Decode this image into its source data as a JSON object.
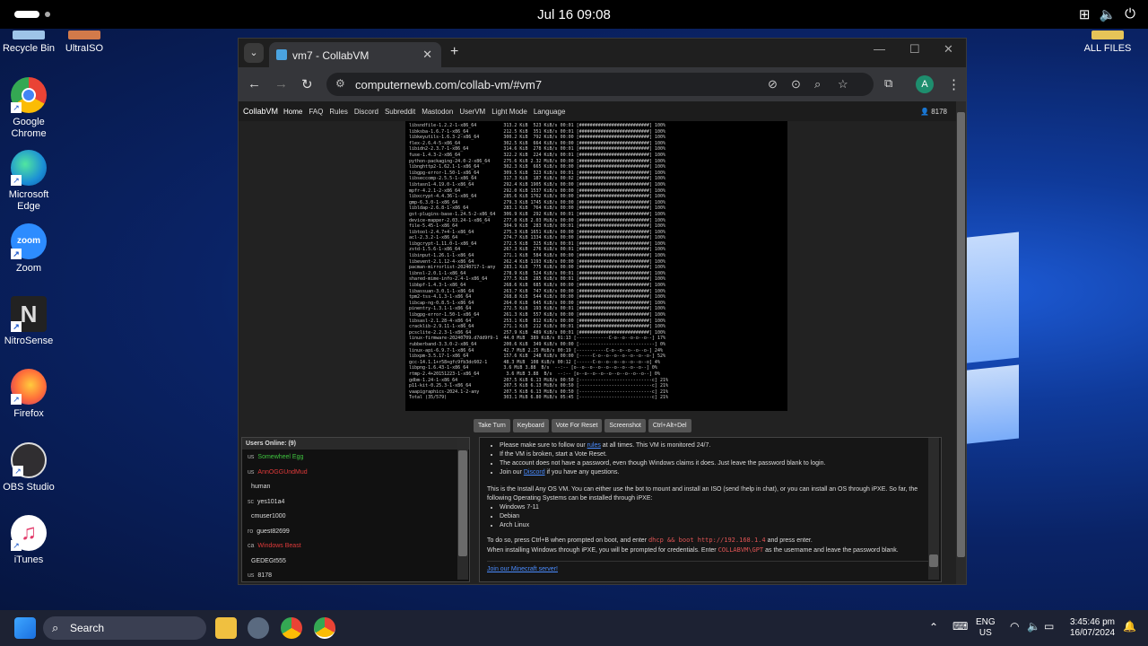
{
  "topbar": {
    "clock": "Jul 16  09:08"
  },
  "desktop": {
    "icons": [
      {
        "label": "Recycle Bin"
      },
      {
        "label": "UltraISO"
      },
      {
        "label": "Google Chrome"
      },
      {
        "label": "Microsoft Edge"
      },
      {
        "label": "Zoom"
      },
      {
        "label": "NitroSense"
      },
      {
        "label": "Firefox"
      },
      {
        "label": "OBS Studio"
      },
      {
        "label": "iTunes"
      },
      {
        "label": "ALL FILES"
      }
    ],
    "icon_labels_inner": {
      "zoom": "zoom"
    }
  },
  "browser": {
    "tab_title": "vm7 - CollabVM",
    "url": "computernewb.com/collab-vm/#vm7",
    "profile_initial": "A"
  },
  "collabvm": {
    "brand": "CollabVM",
    "nav": [
      "Home",
      "FAQ",
      "Rules",
      "Discord",
      "Subreddit",
      "Mastodon",
      "UserVM",
      "Light Mode",
      "Language"
    ],
    "user": "8178",
    "buttons": [
      "Take Turn",
      "Keyboard",
      "Vote For Reset",
      "Screenshot",
      "Ctrl+Alt+Del"
    ],
    "users_header": "Users Online: (9)",
    "users": [
      {
        "cc": "us",
        "name": "Somewheel Egg",
        "color": "#3ec43e"
      },
      {
        "cc": "us",
        "name": "AnnOGGUndMud",
        "color": "#e03a3a"
      },
      {
        "cc": "",
        "name": "human",
        "color": "#dddddd"
      },
      {
        "cc": "sc",
        "name": "yes101a4",
        "color": "#dddddd"
      },
      {
        "cc": "",
        "name": "cmuser1000",
        "color": "#dddddd"
      },
      {
        "cc": "ro",
        "name": "guest82699",
        "color": "#dddddd"
      },
      {
        "cc": "ca",
        "name": "Windows Beast",
        "color": "#e03a3a"
      },
      {
        "cc": "",
        "name": "GEDEGt555",
        "color": "#dddddd"
      },
      {
        "cc": "us",
        "name": "8178",
        "color": "#dddddd"
      }
    ],
    "chat": {
      "bullets": [
        {
          "a": "Please make sure to follow our ",
          "link": "rules",
          "b": " at all times. This VM is monitored 24/7."
        },
        {
          "a": "If the VM is broken, start a Vote Reset.",
          "link": "",
          "b": ""
        },
        {
          "a": "The account does not have a password, even though Windows claims it does. Just leave the password blank to login.",
          "link": "",
          "b": ""
        },
        {
          "a": "Join our ",
          "link": "Discord",
          "b": " if you have any questions."
        }
      ],
      "intro": "This is the Install Any OS VM. You can either use the bot to mount and install an ISO (send !help in chat), or you can install an OS through iPXE. So far, the following Operating Systems can be installed through iPXE:",
      "os_list": [
        "Windows 7-11",
        "Debian",
        "Arch Linux"
      ],
      "do_so_a": "To do so, press Ctrl+B when prompted on boot, and enter ",
      "do_so_code": "dhcp && boot http://192.168.1.4",
      "do_so_b": " and press enter.",
      "creds_a": "When installing Windows through iPXE, you will be prompted for credentials. Enter ",
      "creds_code": "COLLABVM\\GPT",
      "creds_b": " as the username and leave the password blank.",
      "minecraft": "Join our Minecraft server!"
    },
    "terminal_lines": [
      "libsndfile-1.2.2-1-x86_64          313.2 KiB  523 KiB/s 00:01 [##########################] 100%",
      "libksba-1.6.7-1-x86_64             212.5 KiB  351 KiB/s 00:01 [##########################] 100%",
      "libkeyutils-1.6.3-2-x86_64         300.2 KiB  792 KiB/s 00:00 [##########################] 100%",
      "flex-2.6.4-5-x86_64                302.5 KiB  664 KiB/s 00:00 [##########################] 100%",
      "libidn2-2.3.7-1-x86_64             314.6 KiB  278 KiB/s 00:01 [##########################] 100%",
      "fuse-1.4.3-2-x86_64                322.2 KiB  224 KiB/s 00:01 [##########################] 100%",
      "python-packaging-24.0-2-x86_64     275.6 KiB 2.32 MiB/s 00:00 [##########################] 100%",
      "libnghttp2-1.62.1-1-x86_64         302.3 KiB  665 KiB/s 00:00 [##########################] 100%",
      "libgpg-error-1.50-1-x86_64         309.5 KiB  323 KiB/s 00:01 [##########################] 100%",
      "libseccomp-2.5.5-1-x86_64          317.3 KiB  187 KiB/s 00:02 [##########################] 100%",
      "libtasn1-4.19.0-1-x86_64           292.4 KiB 1905 KiB/s 00:00 [##########################] 100%",
      "mpfr-4.2.1-2-x86_64                292.0 KiB 1537 KiB/s 00:00 [##########################] 100%",
      "libxcrypt-4.4.36-1-x86_64          285.6 KiB 1762 KiB/s 00:00 [##########################] 100%",
      "gmp-6.3.0-1-x86_64                 279.3 KiB 1745 KiB/s 00:00 [##########################] 100%",
      "libldap-2.6.8-1-x86_64             283.1 KiB  764 KiB/s 00:00 [##########################] 100%",
      "gst-plugins-base-1.24.5-2-x86_64   306.9 KiB  292 KiB/s 00:01 [##########################] 100%",
      "device-mapper-2.03.24-1-x86_64     277.0 KiB 2.03 MiB/s 00:00 [##########################] 100%",
      "file-5.45-1-x86_64                 304.9 KiB  283 KiB/s 00:01 [##########################] 100%",
      "libtool-2.4.7+4-1-x86_64           275.3 KiB 1651 KiB/s 00:00 [##########################] 100%",
      "acl-2.3.2-1-x86_64                 274.7 KiB 1334 KiB/s 00:00 [##########################] 100%",
      "libgcrypt-1.11.0-1-x86_64          272.5 KiB  325 KiB/s 00:01 [##########################] 100%",
      "zstd-1.5.6-1-x86_64                267.3 KiB  276 KiB/s 00:01 [##########################] 100%",
      "libinput-1.26.1-1-x86_64           271.1 KiB  584 KiB/s 00:00 [##########################] 100%",
      "libevent-2.1.12-4-x86_64           262.4 KiB 1193 KiB/s 00:00 [##########################] 100%",
      "pacman-mirrorlist-20240717-1-any   283.1 KiB  775 KiB/s 00:00 [##########################] 100%",
      "libnsl-2.0.1-1-x86_64              278.9 KiB  524 KiB/s 00:01 [##########################] 100%",
      "shared-mime-info-2.4-1-x86_64      277.5 KiB  285 KiB/s 00:01 [##########################] 100%",
      "libbpf-1.4.3-1-x86_64              268.6 KiB  685 KiB/s 00:00 [##########################] 100%",
      "libassuan-3.0.1-1-x86_64           263.7 KiB  747 KiB/s 00:00 [##########################] 100%",
      "tpm2-tss-4.1.3-1-x86_64            268.8 KiB  544 KiB/s 00:00 [##########################] 100%",
      "libcap-ng-0.8.5-1-x86_64           264.0 KiB  645 KiB/s 00:00 [##########################] 100%",
      "pinentry-1.3.1-1-x86_64            272.5 KiB  193 KiB/s 00:01 [##########################] 100%",
      "libgpg-error-1.50-1-x86_64         261.3 KiB  557 KiB/s 00:00 [##########################] 100%",
      "libsasl-2.1.28-4-x86_64            253.1 KiB  812 KiB/s 00:00 [##########################] 100%",
      "cracklib-2.9.11-1-x86_64           271.1 KiB  212 KiB/s 00:01 [##########################] 100%",
      "pcsclite-2.2.3-1-x86_64            257.9 KiB  489 KiB/s 00:01 [##########################] 100%",
      "linux-firmware-20240709.d7dd9f9-1  44.0 MiB  389 KiB/s 01:13 [------------C-o--o--o-o--o--] 17%",
      "rubberband-3.3.0-2-x86_64          200.6 KiB  349 KiB/s 00:00 [----------------------------] 0%",
      "linux-api-6.9.7-1-x86_64           42.7 MiB 2.25 MiB/s 00:19 [-----------C-o--o--o--o--o-] 24%",
      "libxpm-3.5.17-1-x86_64             157.6 KiB  248 KiB/s 00:00 [-----C-o--o--o--o--o--o--o-] 52%",
      "gcc-14.1.1+r58+gfc9fb3dc602-1      48.3 MiB  108 KiB/s 00:12 [------C-o--o--o--o--o--o--o] 4%",
      "libpng-1.6.43-1-x86_64             3.6 MiB 3.88  B/s  --:-- [o--o--o--o--o--o--o--o--o--] 0%",
      "rtmp-2.4+20151223-1-x86_64          3.6 MiB 3.88  B/s  --:-- [o--o--o--o--o--o--o--o--o--] 0%",
      "gdbm-1.24-1-x86_64                 207.5 KiB 6.13 MiB/s 00:50 [---------------------------c] 21%",
      "p11-kit-0.25.3-1-x86_64            207.5 KiB 6.13 MiB/s 00:50 [---------------------------c] 21%",
      "vaapigraphics-2024.1-2-any         207.5 KiB 6.13 MiB/s 00:50 [---------------------------c] 21%",
      "Total (35/579)                     303.1 MiB 6.80 MiB/s 05:45 [---------------------------c] 21%"
    ]
  },
  "taskbar": {
    "search_placeholder": "Search",
    "lang_top": "ENG",
    "lang_bottom": "US",
    "time": "3:45:46 pm",
    "date": "16/07/2024"
  }
}
